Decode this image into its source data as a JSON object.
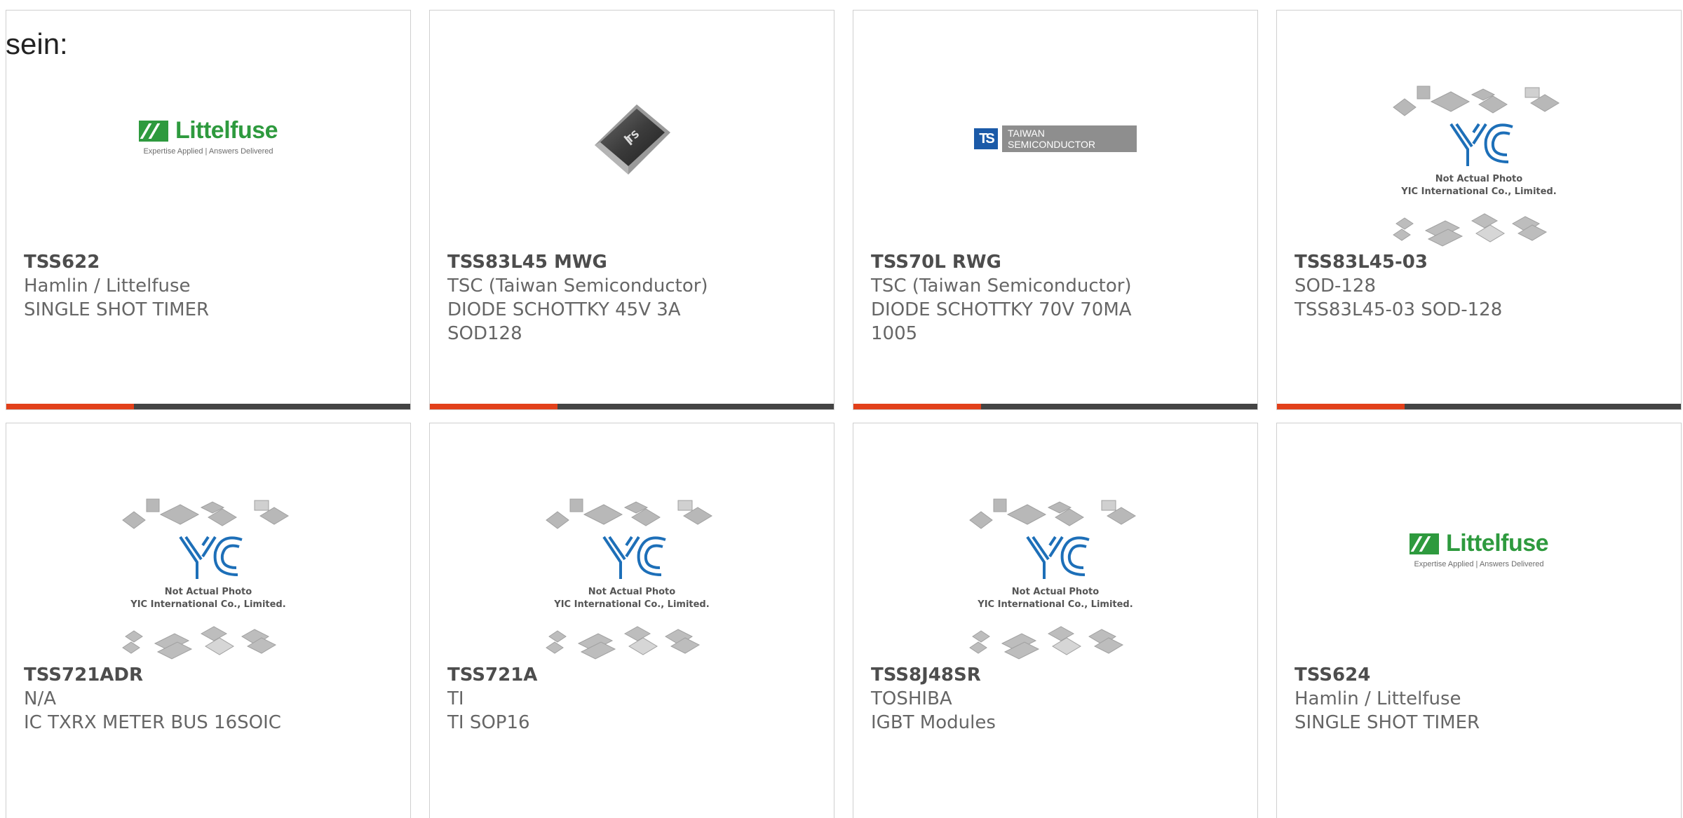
{
  "intro_text": "sein:",
  "cards": [
    {
      "title": "TSS622",
      "lines": [
        "Hamlin / Littelfuse",
        "SINGLE SHOT TIMER"
      ],
      "image": "littelfuse-logo",
      "logo": {
        "name": "Littelfuse",
        "tagline": "Expertise Applied | Answers Delivered"
      }
    },
    {
      "title": "TSS83L45 MWG",
      "lines": [
        "TSC (Taiwan Semiconductor)",
        "DIODE SCHOTTKY 45V 3A",
        "SOD128"
      ],
      "image": "diode-package-photo",
      "logo": {
        "mark": "TS"
      }
    },
    {
      "title": "TSS70L RWG",
      "lines": [
        "TSC (Taiwan Semiconductor)",
        "DIODE SCHOTTKY 70V 70MA",
        "1005"
      ],
      "image": "taiwan-semiconductor-logo",
      "logo": {
        "mark": "TS",
        "line1": "TAIWAN",
        "line2": "SEMICONDUCTOR"
      }
    },
    {
      "title": "TSS83L45-03",
      "lines": [
        "SOD-128",
        "TSS83L45-03 SOD-128"
      ],
      "image": "yic-placeholder",
      "logo": {
        "caption1": "Not Actual Photo",
        "caption2": "YIC International Co., Limited."
      }
    },
    {
      "title": "TSS721ADR",
      "lines": [
        "N/A",
        "IC TXRX METER BUS 16SOIC"
      ],
      "image": "yic-placeholder",
      "logo": {
        "caption1": "Not Actual Photo",
        "caption2": "YIC International Co., Limited."
      }
    },
    {
      "title": "TSS721A",
      "lines": [
        "TI",
        "TI SOP16"
      ],
      "image": "yic-placeholder",
      "logo": {
        "caption1": "Not Actual Photo",
        "caption2": "YIC International Co., Limited."
      }
    },
    {
      "title": "TSS8J48SR",
      "lines": [
        "TOSHIBA",
        "IGBT Modules"
      ],
      "image": "yic-placeholder",
      "logo": {
        "caption1": "Not Actual Photo",
        "caption2": "YIC International Co., Limited."
      }
    },
    {
      "title": "TSS624",
      "lines": [
        "Hamlin / Littelfuse",
        "SINGLE SHOT TIMER"
      ],
      "image": "littelfuse-logo",
      "logo": {
        "name": "Littelfuse",
        "tagline": "Expertise Applied | Answers Delivered"
      }
    }
  ],
  "colors": {
    "accent_bar": "#e2401a",
    "bar": "#444444",
    "littelfuse_green": "#2e9a3e",
    "yic_blue": "#1d6fb8",
    "title_text": "#4d4d4d",
    "body_text": "#666666"
  }
}
